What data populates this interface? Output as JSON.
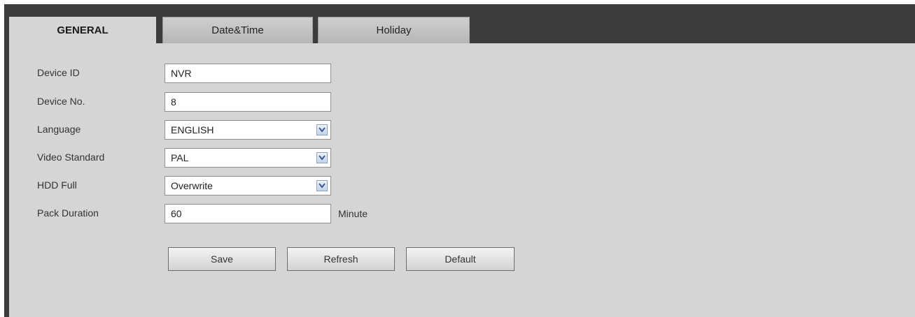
{
  "tabs": {
    "general": "GENERAL",
    "date_time": "Date&Time",
    "holiday": "Holiday"
  },
  "form": {
    "device_id": {
      "label": "Device ID",
      "value": "NVR"
    },
    "device_no": {
      "label": "Device No.",
      "value": "8"
    },
    "language": {
      "label": "Language",
      "value": "ENGLISH"
    },
    "video_standard": {
      "label": "Video Standard",
      "value": "PAL"
    },
    "hdd_full": {
      "label": "HDD Full",
      "value": "Overwrite"
    },
    "pack_duration": {
      "label": "Pack Duration",
      "value": "60",
      "unit": "Minute"
    }
  },
  "buttons": {
    "save": "Save",
    "refresh": "Refresh",
    "default": "Default"
  },
  "icons": {
    "dropdown": "chevron-down-icon"
  },
  "colors": {
    "frame": "#3c3c3c",
    "panel": "#d5d5d5",
    "dropdown_arrow": "#3a5a8c"
  }
}
